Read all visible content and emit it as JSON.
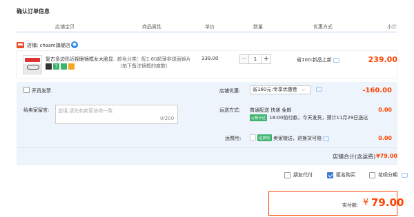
{
  "page_title": "确认订单信息",
  "columns": [
    "店铺宝贝",
    "商品属性",
    "单价",
    "数量",
    "优惠方式",
    "小计"
  ],
  "shop": {
    "label": "店铺: chasm旗舰店"
  },
  "item": {
    "name": "复古多边形近视眼镜框女大脸显...",
    "property": "颜色分类：配1.60超薄非球面镜片（拍下备注镜框的度数）",
    "price": "339.00",
    "quantity": "1",
    "minus": "−",
    "plus": "+",
    "discount": "省100:新品上新",
    "subtotal": "239.00"
  },
  "invoice": {
    "label": "开具发票"
  },
  "memo": {
    "label": "给卖家留言:",
    "placeholder": "选填,请先和商家协商一致",
    "count": "0/200"
  },
  "coupon": {
    "label": "店铺优惠:",
    "selected": "省160元:专享优惠卷",
    "value": "-160.00"
  },
  "shipping": {
    "label": "运送方式:",
    "line1": "普通配送 快递 免邮",
    "tag": "◎预计达",
    "line2": "18:00前付款，今天发货，预计11月29日送达",
    "value": "0.00"
  },
  "insurance": {
    "label": "运费险:",
    "tag": "运费险",
    "text": "卖家赠送，退换货可赔",
    "value": "0.00"
  },
  "shop_total": {
    "label": "店铺合计(含运费)",
    "value": "¥79.00"
  },
  "options": {
    "friend_pay": "朋友代付",
    "anonymous": "匿名购买",
    "installment": "花呗分期"
  },
  "payment": {
    "label": "实付款:",
    "currency": "¥",
    "amount": "79.00"
  },
  "colors": {
    "accent": "#ff4400",
    "panel": "#eef4fb",
    "checked": "#3a7bd5",
    "green": "#3cb46e"
  }
}
